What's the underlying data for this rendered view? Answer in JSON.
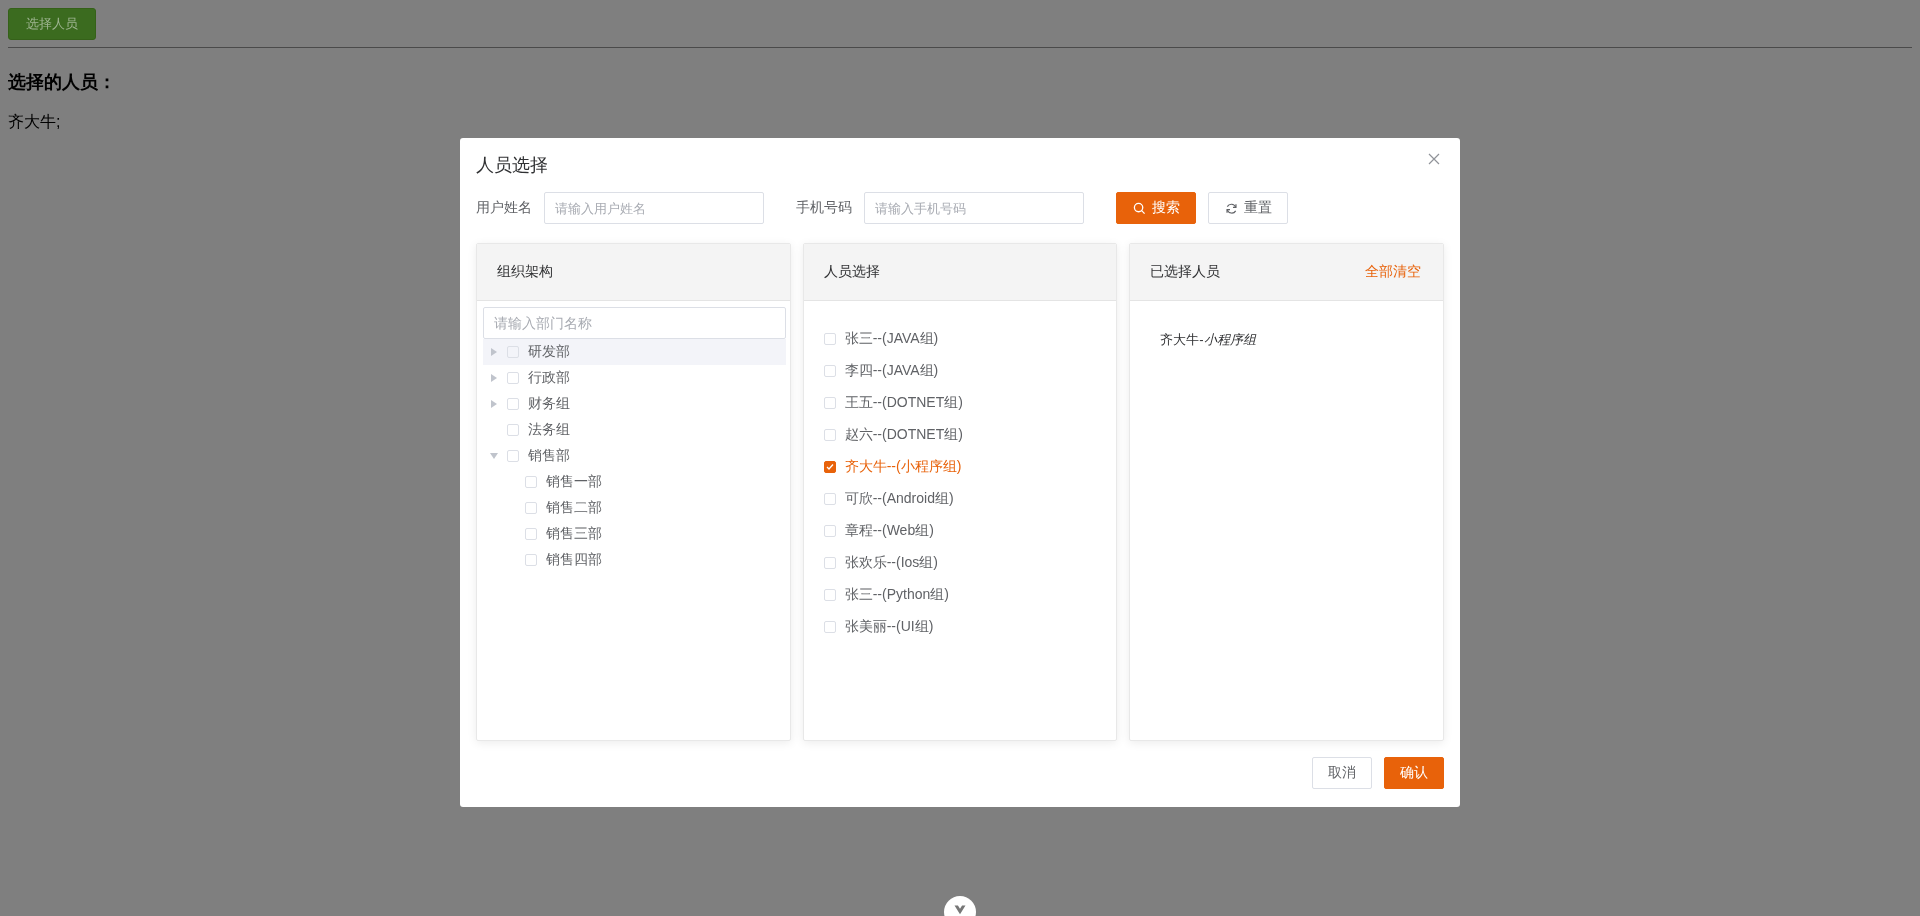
{
  "page": {
    "open_button": "选择人员",
    "heading": "选择的人员：",
    "result": "齐大牛;"
  },
  "dialog": {
    "title": "人员选择",
    "filters": [
      {
        "label": "用户姓名",
        "placeholder": "请输入用户姓名"
      },
      {
        "label": "手机号码",
        "placeholder": "请输入手机号码"
      }
    ],
    "actions": [
      {
        "label": "搜索",
        "kind": "search"
      },
      {
        "label": "重置",
        "kind": "reset"
      }
    ],
    "org_panel": {
      "title": "组织架构",
      "search": {
        "placeholder": "请输入部门名称"
      },
      "tree": [
        {
          "label": "研发部",
          "checked": false,
          "hovered": true,
          "expanded": false
        },
        {
          "label": "行政部",
          "checked": false,
          "hovered": false,
          "expanded": false
        },
        {
          "label": "财务组",
          "checked": false,
          "hovered": false,
          "expanded": false
        },
        {
          "label": "法务组",
          "checked": false,
          "hovered": false
        },
        {
          "label": "销售部",
          "checked": false,
          "hovered": false,
          "expanded": true,
          "children": [
            {
              "label": "销售一部",
              "checked": false,
              "hovered": false
            },
            {
              "label": "销售二部",
              "checked": false,
              "hovered": false
            },
            {
              "label": "销售三部",
              "checked": false,
              "hovered": false
            },
            {
              "label": "销售四部",
              "checked": false,
              "hovered": false
            }
          ]
        }
      ]
    },
    "people_panel": {
      "title": "人员选择",
      "people": [
        {
          "label": "张三--(JAVA组)",
          "checked": false
        },
        {
          "label": "李四--(JAVA组)",
          "checked": false
        },
        {
          "label": "王五--(DOTNET组)",
          "checked": false
        },
        {
          "label": "赵六--(DOTNET组)",
          "checked": false
        },
        {
          "label": "齐大牛--(小程序组)",
          "checked": true
        },
        {
          "label": "可欣--(Android组)",
          "checked": false
        },
        {
          "label": "章程--(Web组)",
          "checked": false
        },
        {
          "label": "张欢乐--(Ios组)",
          "checked": false
        },
        {
          "label": "张三--(Python组)",
          "checked": false
        },
        {
          "label": "张美丽--(UI组)",
          "checked": false
        }
      ]
    },
    "selected_panel": {
      "title": "已选择人员",
      "clear_link": "全部清空",
      "items": [
        "齐大牛-*小程序组*"
      ]
    },
    "footer": [
      {
        "label": "取消",
        "kind": "default"
      },
      {
        "label": "确认",
        "kind": "primary"
      }
    ]
  }
}
